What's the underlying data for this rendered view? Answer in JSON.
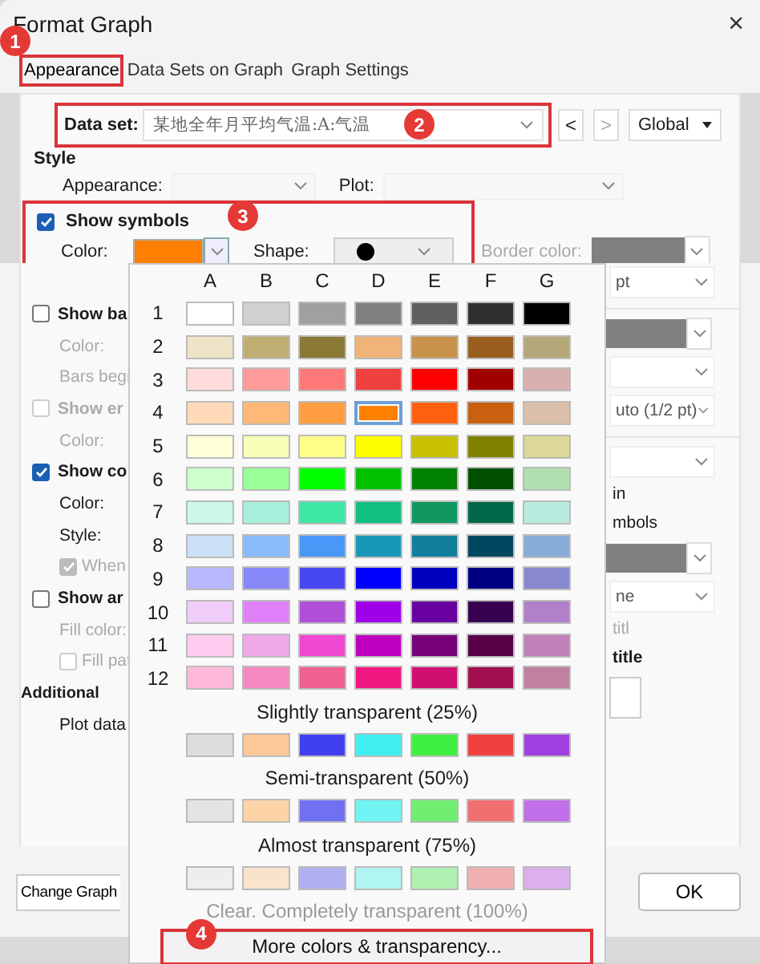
{
  "window": {
    "title": "Format Graph",
    "close": "×"
  },
  "tabs": [
    {
      "label": "Appearance",
      "selected": true,
      "annotation": "1"
    },
    {
      "label": "Data Sets on Graph",
      "selected": false
    },
    {
      "label": "Graph Settings",
      "selected": false
    }
  ],
  "data_set": {
    "label": "Data set:",
    "value": "某地全年月平均气温:A:气温",
    "annotation": "2",
    "prev": "<",
    "next": ">",
    "scope": "Global"
  },
  "style": {
    "heading": "Style",
    "appearance_label": "Appearance:",
    "plot_label": "Plot:"
  },
  "show_symbols": {
    "label": "Show symbols",
    "checked": true,
    "annotation": "3",
    "color_label": "Color:",
    "color": "#ff8000",
    "shape_label": "Shape:",
    "border_color_label": "Border color:"
  },
  "left_items": [
    {
      "kind": "checkbox",
      "label": "Show ba",
      "checked": false,
      "disabled": false
    },
    {
      "kind": "label",
      "label": "Color:",
      "disabled": true
    },
    {
      "kind": "label",
      "label": "Bars begi",
      "disabled": true
    },
    {
      "kind": "checkbox",
      "label": "Show er",
      "checked": false,
      "disabled": true
    },
    {
      "kind": "label",
      "label": "Color:",
      "disabled": true
    },
    {
      "kind": "checkbox",
      "label": "Show co",
      "checked": true,
      "disabled": false
    },
    {
      "kind": "label",
      "label": "Color:",
      "disabled": false
    },
    {
      "kind": "label",
      "label": "Style:",
      "disabled": false
    },
    {
      "kind": "option",
      "label": "When",
      "checked": true,
      "disabled": true
    },
    {
      "kind": "checkbox",
      "label": "Show ar",
      "checked": false,
      "disabled": false
    },
    {
      "kind": "label",
      "label": "Fill color:",
      "disabled": true
    },
    {
      "kind": "option",
      "label": "Fill pat",
      "checked": false,
      "disabled": true
    },
    {
      "kind": "heading",
      "label": "Additional"
    },
    {
      "kind": "label",
      "label": "Plot data",
      "disabled": false
    }
  ],
  "right_items": [
    {
      "kind": "dropdown",
      "value": "pt"
    },
    {
      "kind": "swatch"
    },
    {
      "kind": "dropdown"
    },
    {
      "kind": "dropdown",
      "value": "uto (1/2 pt)"
    },
    {
      "kind": "dropdown"
    },
    {
      "kind": "text",
      "label": "in"
    },
    {
      "kind": "text",
      "label": "mbols"
    },
    {
      "kind": "swatch"
    },
    {
      "kind": "dropdown",
      "value": "ne"
    },
    {
      "kind": "faint",
      "label": "titl"
    },
    {
      "kind": "heading",
      "label": "title"
    },
    {
      "kind": "box"
    }
  ],
  "buttons": {
    "change_graph": "Change Graph",
    "ok": "OK"
  },
  "palette": {
    "columns": [
      "A",
      "B",
      "C",
      "D",
      "E",
      "F",
      "G"
    ],
    "rows": [
      {
        "label": "1",
        "swatches": [
          {
            "color": "#ffffff",
            "selected": false
          },
          {
            "color": "#d0d0d0",
            "selected": false
          },
          {
            "color": "#a0a0a0",
            "selected": false
          },
          {
            "color": "#808080",
            "selected": false
          },
          {
            "color": "#606060",
            "selected": false
          },
          {
            "color": "#303030",
            "selected": false
          },
          {
            "color": "#000000",
            "selected": false
          }
        ]
      },
      {
        "label": "2",
        "swatches": [
          {
            "color": "#ede3c6",
            "selected": false
          },
          {
            "color": "#bfae72",
            "selected": false
          },
          {
            "color": "#8a7835",
            "selected": false
          },
          {
            "color": "#f0b478",
            "selected": false
          },
          {
            "color": "#c8924a",
            "selected": false
          },
          {
            "color": "#9a5f1e",
            "selected": false
          },
          {
            "color": "#b5a878",
            "selected": false
          }
        ]
      },
      {
        "label": "3",
        "swatches": [
          {
            "color": "#ffdcdc",
            "selected": false
          },
          {
            "color": "#ff9a9a",
            "selected": false
          },
          {
            "color": "#ff7878",
            "selected": false
          },
          {
            "color": "#f04040",
            "selected": false
          },
          {
            "color": "#ff0000",
            "selected": false
          },
          {
            "color": "#a00000",
            "selected": false
          },
          {
            "color": "#d8b0b0",
            "selected": false
          }
        ]
      },
      {
        "label": "4",
        "swatches": [
          {
            "color": "#ffd9b8",
            "selected": false
          },
          {
            "color": "#ffb877",
            "selected": false
          },
          {
            "color": "#ff9d40",
            "selected": false
          },
          {
            "color": "#ff8000",
            "selected": true
          },
          {
            "color": "#ff6010",
            "selected": false
          },
          {
            "color": "#c86010",
            "selected": false
          },
          {
            "color": "#dbbfaa",
            "selected": false
          }
        ]
      },
      {
        "label": "5",
        "swatches": [
          {
            "color": "#ffffd8",
            "selected": false
          },
          {
            "color": "#f8ffb8",
            "selected": false
          },
          {
            "color": "#ffff88",
            "selected": false
          },
          {
            "color": "#ffff00",
            "selected": false
          },
          {
            "color": "#c8c000",
            "selected": false
          },
          {
            "color": "#808000",
            "selected": false
          },
          {
            "color": "#dcd898",
            "selected": false
          }
        ]
      },
      {
        "label": "6",
        "swatches": [
          {
            "color": "#ccffcc",
            "selected": false
          },
          {
            "color": "#99ff99",
            "selected": false
          },
          {
            "color": "#00ff00",
            "selected": false
          },
          {
            "color": "#00c000",
            "selected": false
          },
          {
            "color": "#008000",
            "selected": false
          },
          {
            "color": "#005000",
            "selected": false
          },
          {
            "color": "#b0e0b0",
            "selected": false
          }
        ]
      },
      {
        "label": "7",
        "swatches": [
          {
            "color": "#ccf8ec",
            "selected": false
          },
          {
            "color": "#a8f0dc",
            "selected": false
          },
          {
            "color": "#40e8a8",
            "selected": false
          },
          {
            "color": "#10c080",
            "selected": false
          },
          {
            "color": "#109860",
            "selected": false
          },
          {
            "color": "#006848",
            "selected": false
          },
          {
            "color": "#b8ece0",
            "selected": false
          }
        ]
      },
      {
        "label": "8",
        "swatches": [
          {
            "color": "#cce0f8",
            "selected": false
          },
          {
            "color": "#88bcf8",
            "selected": false
          },
          {
            "color": "#4898f8",
            "selected": false
          },
          {
            "color": "#1898b8",
            "selected": false
          },
          {
            "color": "#10809c",
            "selected": false
          },
          {
            "color": "#004860",
            "selected": false
          },
          {
            "color": "#88acd8",
            "selected": false
          }
        ]
      },
      {
        "label": "9",
        "swatches": [
          {
            "color": "#b8b8ff",
            "selected": false
          },
          {
            "color": "#8888f8",
            "selected": false
          },
          {
            "color": "#4848f0",
            "selected": false
          },
          {
            "color": "#0000ff",
            "selected": false
          },
          {
            "color": "#0000c0",
            "selected": false
          },
          {
            "color": "#000080",
            "selected": false
          },
          {
            "color": "#8888d0",
            "selected": false
          }
        ]
      },
      {
        "label": "10",
        "swatches": [
          {
            "color": "#f0ccf8",
            "selected": false
          },
          {
            "color": "#e080f8",
            "selected": false
          },
          {
            "color": "#b050d8",
            "selected": false
          },
          {
            "color": "#a000e8",
            "selected": false
          },
          {
            "color": "#6800a0",
            "selected": false
          },
          {
            "color": "#380050",
            "selected": false
          },
          {
            "color": "#b080c8",
            "selected": false
          }
        ]
      },
      {
        "label": "11",
        "swatches": [
          {
            "color": "#ffccf0",
            "selected": false
          },
          {
            "color": "#f0a8e8",
            "selected": false
          },
          {
            "color": "#f048d0",
            "selected": false
          },
          {
            "color": "#c000c0",
            "selected": false
          },
          {
            "color": "#780078",
            "selected": false
          },
          {
            "color": "#580048",
            "selected": false
          },
          {
            "color": "#c080b8",
            "selected": false
          }
        ]
      },
      {
        "label": "12",
        "swatches": [
          {
            "color": "#ffb8d8",
            "selected": false
          },
          {
            "color": "#f888c0",
            "selected": false
          },
          {
            "color": "#f06090",
            "selected": false
          },
          {
            "color": "#f01880",
            "selected": false
          },
          {
            "color": "#d01070",
            "selected": false
          },
          {
            "color": "#a01050",
            "selected": false
          },
          {
            "color": "#c080a0",
            "selected": false
          }
        ]
      }
    ],
    "transparency": [
      {
        "label": "Slightly transparent (25%)",
        "swatches": [
          {
            "color": "#dcdcdc",
            "selected": false
          },
          {
            "color": "#ffc89a",
            "selected": false
          },
          {
            "color": "#4040f0",
            "selected": false
          },
          {
            "color": "#40f0f0",
            "selected": false
          },
          {
            "color": "#40f040",
            "selected": false
          },
          {
            "color": "#f04040",
            "selected": false
          },
          {
            "color": "#a040e0",
            "selected": false
          }
        ]
      },
      {
        "label": "Semi-transparent (50%)",
        "swatches": [
          {
            "color": "#e4e4e4",
            "selected": false
          },
          {
            "color": "#fcd4a8",
            "selected": false
          },
          {
            "color": "#7070f0",
            "selected": false
          },
          {
            "color": "#70f4f4",
            "selected": false
          },
          {
            "color": "#70ee70",
            "selected": false
          },
          {
            "color": "#f07070",
            "selected": false
          },
          {
            "color": "#c070e8",
            "selected": false
          }
        ]
      },
      {
        "label": "Almost transparent (75%)",
        "swatches": [
          {
            "color": "#eeeeee",
            "selected": false
          },
          {
            "color": "#f8e4cc",
            "selected": false
          },
          {
            "color": "#b0b0f0",
            "selected": false
          },
          {
            "color": "#b0f4f4",
            "selected": false
          },
          {
            "color": "#b0f0b0",
            "selected": false
          },
          {
            "color": "#f0b0b0",
            "selected": false
          },
          {
            "color": "#dcb0ec",
            "selected": false
          }
        ]
      }
    ],
    "clear_label": "Clear. Completely transparent (100%)",
    "more_button": {
      "label": "More colors & transparency...",
      "annotation": "4"
    }
  }
}
